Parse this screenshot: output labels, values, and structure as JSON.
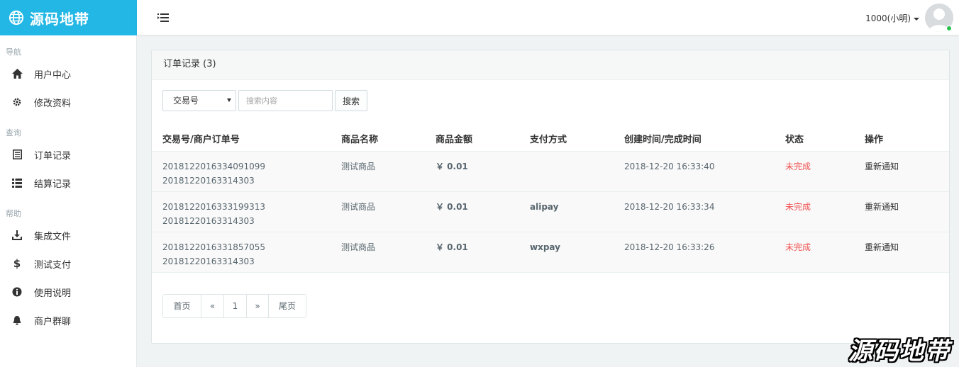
{
  "brand": {
    "title": "源码地带",
    "icon": "globe-icon"
  },
  "header": {
    "user_label": "1000(小明)"
  },
  "sidebar": {
    "sections": [
      {
        "label": "导航",
        "items": [
          {
            "label": "用户中心",
            "icon": "home-icon"
          },
          {
            "label": "修改资料",
            "icon": "gear-icon"
          }
        ]
      },
      {
        "label": "查询",
        "items": [
          {
            "label": "订单记录",
            "icon": "list-alt-icon"
          },
          {
            "label": "结算记录",
            "icon": "list-icon"
          }
        ]
      },
      {
        "label": "帮助",
        "items": [
          {
            "label": "集成文件",
            "icon": "download-icon"
          },
          {
            "label": "测试支付",
            "icon": "dollar-icon"
          },
          {
            "label": "使用说明",
            "icon": "info-icon"
          },
          {
            "label": "商户群聊",
            "icon": "bell-icon"
          }
        ]
      }
    ]
  },
  "panel": {
    "title": "订单记录 (3)",
    "filter": {
      "selected": "交易号",
      "placeholder": "搜索内容",
      "search_label": "搜索"
    },
    "columns": [
      "交易号/商户订单号",
      "商品名称",
      "商品金额",
      "支付方式",
      "创建时间/完成时间",
      "状态",
      "操作"
    ],
    "rows": [
      {
        "trade_no": "2018122016334091099",
        "order_no": "20181220163314303",
        "product": "测试商品",
        "amount": "￥ 0.01",
        "pay": "",
        "time": "2018-12-20 16:33:40",
        "status": "未完成",
        "action": "重新通知"
      },
      {
        "trade_no": "2018122016333199313",
        "order_no": "20181220163314303",
        "product": "测试商品",
        "amount": "￥ 0.01",
        "pay": "alipay",
        "time": "2018-12-20 16:33:34",
        "status": "未完成",
        "action": "重新通知"
      },
      {
        "trade_no": "2018122016331857055",
        "order_no": "20181220163314303",
        "product": "测试商品",
        "amount": "￥ 0.01",
        "pay": "wxpay",
        "time": "2018-12-20 16:33:26",
        "status": "未完成",
        "action": "重新通知"
      }
    ],
    "pagination": {
      "first": "首页",
      "prev": "«",
      "current": "1",
      "next": "»",
      "last": "尾页"
    }
  },
  "watermark": "源码地带",
  "colors": {
    "brand": "#23b7e5",
    "status_pending": "#f05050",
    "online": "#27c24c"
  }
}
